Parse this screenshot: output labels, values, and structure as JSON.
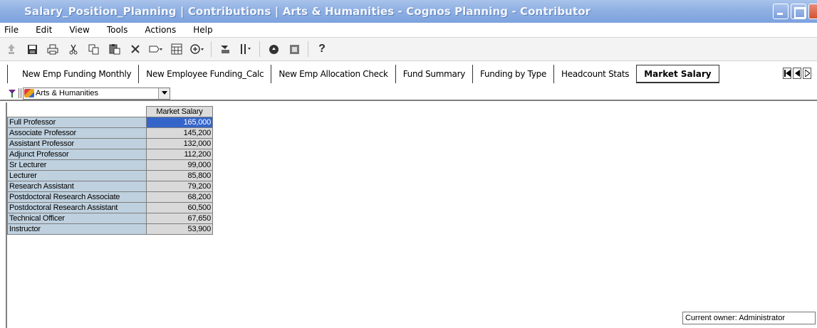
{
  "window": {
    "title": "Salary_Position_Planning | Contributions | Arts & Humanities - Cognos Planning - Contributor"
  },
  "menu": [
    "File",
    "Edit",
    "View",
    "Tools",
    "Actions",
    "Help"
  ],
  "toolbar": {
    "icons": [
      "upload-icon",
      "save-icon",
      "print-icon",
      "cut-icon",
      "copy-icon",
      "paste-icon",
      "delete-icon",
      "fill-icon",
      "grid-icon",
      "breakback-icon",
      "import-icon",
      "tools-icon",
      "go-icon",
      "stop-icon",
      "help-icon"
    ],
    "help_label": "?"
  },
  "tabs": [
    {
      "label": "New Emp Funding Monthly",
      "active": false
    },
    {
      "label": "New Employee Funding_Calc",
      "active": false
    },
    {
      "label": "New Emp Allocation Check",
      "active": false
    },
    {
      "label": "Fund Summary",
      "active": false
    },
    {
      "label": "Funding by Type",
      "active": false
    },
    {
      "label": "Headcount Stats",
      "active": false
    },
    {
      "label": "Market Salary",
      "active": true
    }
  ],
  "selector": {
    "value": "Arts & Humanities"
  },
  "grid": {
    "column_header": "Market Salary",
    "rows": [
      {
        "label": "Full Professor",
        "value": "165,000",
        "selected": true
      },
      {
        "label": "Associate Professor",
        "value": "145,200"
      },
      {
        "label": "Assistant Professor",
        "value": "132,000"
      },
      {
        "label": "Adjunct Professor",
        "value": "112,200"
      },
      {
        "label": "Sr Lecturer",
        "value": "99,000"
      },
      {
        "label": "Lecturer",
        "value": "85,800"
      },
      {
        "label": "Research Assistant",
        "value": "79,200"
      },
      {
        "label": "Postdoctoral Research Associate",
        "value": "68,200"
      },
      {
        "label": "Postdoctoral Research Assistant",
        "value": "60,500"
      },
      {
        "label": "Technical Officer",
        "value": "67,650"
      },
      {
        "label": "Instructor",
        "value": "53,900"
      }
    ]
  },
  "status": {
    "owner": "Current owner: Administrator"
  }
}
